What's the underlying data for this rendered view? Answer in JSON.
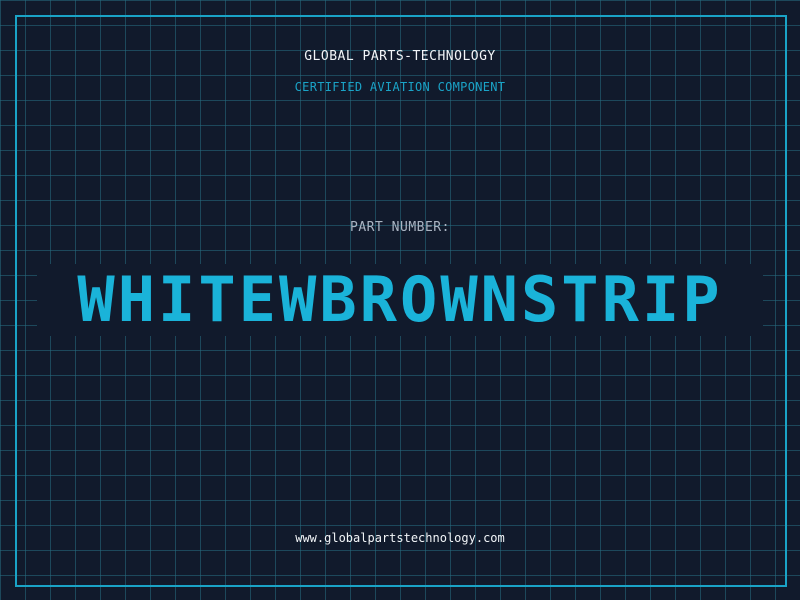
{
  "header": {
    "company": "GLOBAL PARTS-TECHNOLOGY",
    "subtitle": "CERTIFIED AVIATION COMPONENT"
  },
  "part": {
    "label": "PART NUMBER:",
    "number": "WHITEWBROWNSTRIP"
  },
  "footer": {
    "url": "www.globalpartstechnology.com"
  },
  "colors": {
    "background": "#111a2c",
    "grid": "#266e82",
    "accent": "#1aa3c7",
    "text": "#f2f5f8",
    "label": "#aab4c2"
  }
}
